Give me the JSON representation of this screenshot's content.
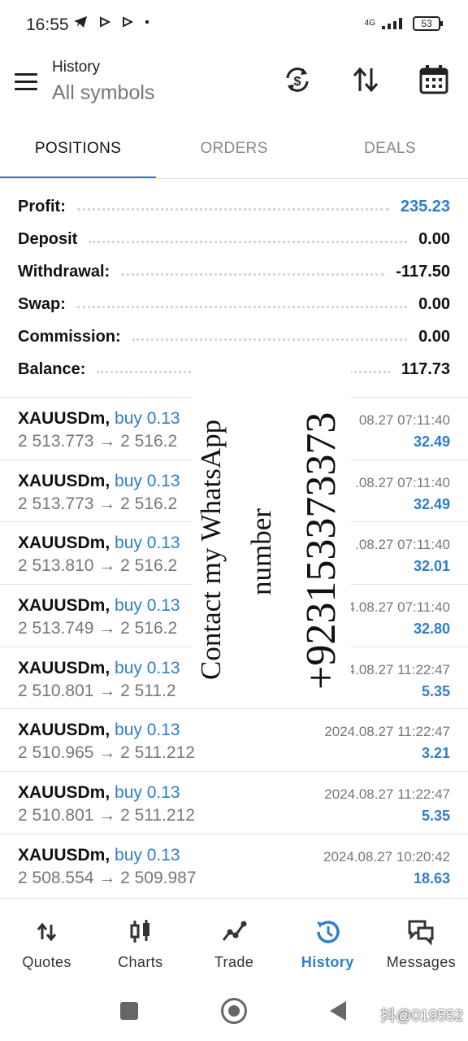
{
  "status_bar": {
    "time": "16:55",
    "network": "4G",
    "battery": "53"
  },
  "header": {
    "title": "History",
    "subtitle": "All symbols"
  },
  "tabs": [
    {
      "label": "POSITIONS"
    },
    {
      "label": "ORDERS"
    },
    {
      "label": "DEALS"
    }
  ],
  "summary": [
    {
      "label": "Profit:",
      "value": "235.23"
    },
    {
      "label": "Deposit",
      "value": "0.00"
    },
    {
      "label": "Withdrawal:",
      "value": "-117.50"
    },
    {
      "label": "Swap:",
      "value": "0.00"
    },
    {
      "label": "Commission:",
      "value": "0.00"
    },
    {
      "label": "Balance:",
      "value": "117.73"
    }
  ],
  "deals": [
    {
      "symbol": "XAUUSDm,",
      "direction": "buy 0.13",
      "prices": "2 513.773 → 2 516.2",
      "time": "08.27 07:11:40",
      "profit": "32.49"
    },
    {
      "symbol": "XAUUSDm,",
      "direction": "buy 0.13",
      "prices": "2 513.773 → 2 516.2",
      "time": ".08.27 07:11:40",
      "profit": "32.49"
    },
    {
      "symbol": "XAUUSDm,",
      "direction": "buy 0.13",
      "prices": "2 513.810 → 2 516.2",
      "time": ".08.27 07:11:40",
      "profit": "32.01"
    },
    {
      "symbol": "XAUUSDm,",
      "direction": "buy 0.13",
      "prices": "2 513.749 → 2 516.2",
      "time": "4.08.27 07:11:40",
      "profit": "32.80"
    },
    {
      "symbol": "XAUUSDm,",
      "direction": "buy 0.13",
      "prices": "2 510.801 → 2 511.2",
      "time": "4.08.27 11:22:47",
      "profit": "5.35"
    },
    {
      "symbol": "XAUUSDm,",
      "direction": "buy 0.13",
      "prices": "2 510.965 → 2 511.212",
      "time": "2024.08.27 11:22:47",
      "profit": "3.21"
    },
    {
      "symbol": "XAUUSDm,",
      "direction": "buy 0.13",
      "prices": "2 510.801 → 2 511.212",
      "time": "2024.08.27 11:22:47",
      "profit": "5.35"
    },
    {
      "symbol": "XAUUSDm,",
      "direction": "buy 0.13",
      "prices": "2 508.554 → 2 509.987",
      "time": "2024.08.27 10:20:42",
      "profit": "18.63"
    }
  ],
  "overlay": {
    "line1": "Contact my WhatsApp",
    "line2": "number",
    "line3": "+923153373373"
  },
  "bottom_nav": [
    {
      "label": "Quotes",
      "icon": "quotes-icon"
    },
    {
      "label": "Charts",
      "icon": "charts-icon"
    },
    {
      "label": "Trade",
      "icon": "trade-icon"
    },
    {
      "label": "History",
      "icon": "history-icon",
      "active": true
    },
    {
      "label": "Messages",
      "icon": "messages-icon"
    }
  ],
  "watermark": "抖@019552",
  "colors": {
    "accent": "#2f7ec9",
    "text": "#111111",
    "muted": "#777777"
  }
}
